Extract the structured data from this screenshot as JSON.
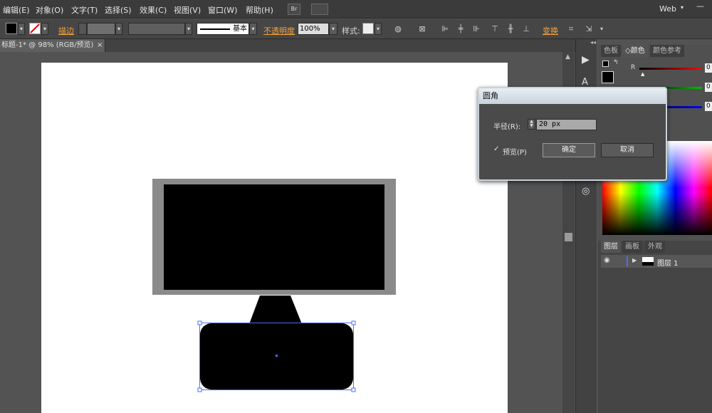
{
  "menu": {
    "items": [
      "编辑(E)",
      "对象(O)",
      "文字(T)",
      "选择(S)",
      "效果(C)",
      "视图(V)",
      "窗口(W)",
      "帮助(H)"
    ],
    "br_label": "Br",
    "workspace": "Web"
  },
  "control_bar": {
    "stroke_label": "描边",
    "stroke_style": "基本",
    "opacity_label": "不透明度",
    "opacity_value": "100%",
    "style_label": "样式:",
    "transform_label": "变换"
  },
  "document_tab": {
    "title": "标题-1* @ 98% (RGB/预览)",
    "close": "×"
  },
  "color_panel": {
    "tabs": [
      "色板",
      "颜色",
      "颜色参考"
    ],
    "active_tab": "颜色",
    "r_label": "R",
    "values": [
      "0",
      "0",
      "0"
    ],
    "colors": {
      "red": "#ff0000",
      "green": "#00c000",
      "blue": "#0000ff"
    }
  },
  "layers_panel": {
    "tabs": [
      "图层",
      "画板",
      "外观"
    ],
    "layer_name": "图层 1"
  },
  "dialog": {
    "title": "圆角",
    "radius_label": "半径(R):",
    "radius_value": "20 px",
    "preview_label": "预览(P)",
    "preview_checked": true,
    "ok_label": "确定",
    "cancel_label": "取消"
  },
  "artwork": {
    "colors": {
      "frame": "#888888",
      "screen": "#000000",
      "stand": "#000000",
      "selection": "#4a6cf7"
    }
  }
}
